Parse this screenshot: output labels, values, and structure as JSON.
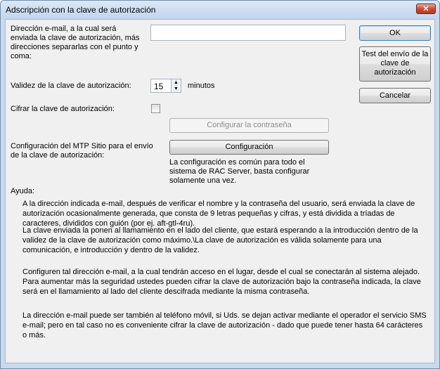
{
  "window": {
    "title": "Adscripción con la clave de autorización",
    "close_glyph": "✕"
  },
  "email": {
    "label": "Dirección e-mail, a la cual será enviada la clave de autorización, más direcciones separarlas con el punto y coma:",
    "value": "",
    "placeholder": ""
  },
  "validity": {
    "label": "Validez de la clave de autorización:",
    "value": "15",
    "unit": "minutos"
  },
  "encrypt": {
    "label": "Cifrar la clave de autorización:",
    "checked": false,
    "button_label": "Configurar la contraseña"
  },
  "smtp": {
    "label": "Configuración del MTP Sitio para el envío de la clave de autorización:",
    "button_label": "Configuración",
    "note": "La configuración es común para todo el sistema de RAC Server, basta configurar solamente una vez."
  },
  "buttons": {
    "ok": "OK",
    "test": "Test del envío de la clave de autorización",
    "cancel": "Cancelar"
  },
  "help": {
    "title": "Ayuda:",
    "paragraphs": [
      "A la dirección indicada e-mail, después de verificar el nombre y la contraseña del usuario, será enviada la clave de autorización ocasionalmente generada, que consta de 9 letras pequeñas y cifras, y está dividida a tríadas de caracteres, divididos con guión (por ej. aft-gtl-4ru).",
      "La clave enviada la ponen al llamamiento en el lado del cliente, que estará esperando a la introducción dentro de la validez de la clave de autorización como máximo.\\La clave de autorización es válida solamente para una comunicación, e introducción y dentro de la validez.",
      "Configuren tal dirección e-mail, a la cual tendrán acceso en el lugar, desde el cual se conectarán al sistema alejado. Para aumentar más la seguridad ustedes pueden cifrar la clave de autorización bajo la contraseña indicada, la clave será en el llamamiento al lado del cliente descifrada mediante la misma contraseña.",
      "La dirección e-mail puede ser también al teléfono móvil, si Uds. se dejan activar mediante el operador el servicio SMS e-mail; pero en tal caso no es conveniente cifrar la clave de autorización - dado que puede tener hasta 64 carácteres o más."
    ]
  }
}
